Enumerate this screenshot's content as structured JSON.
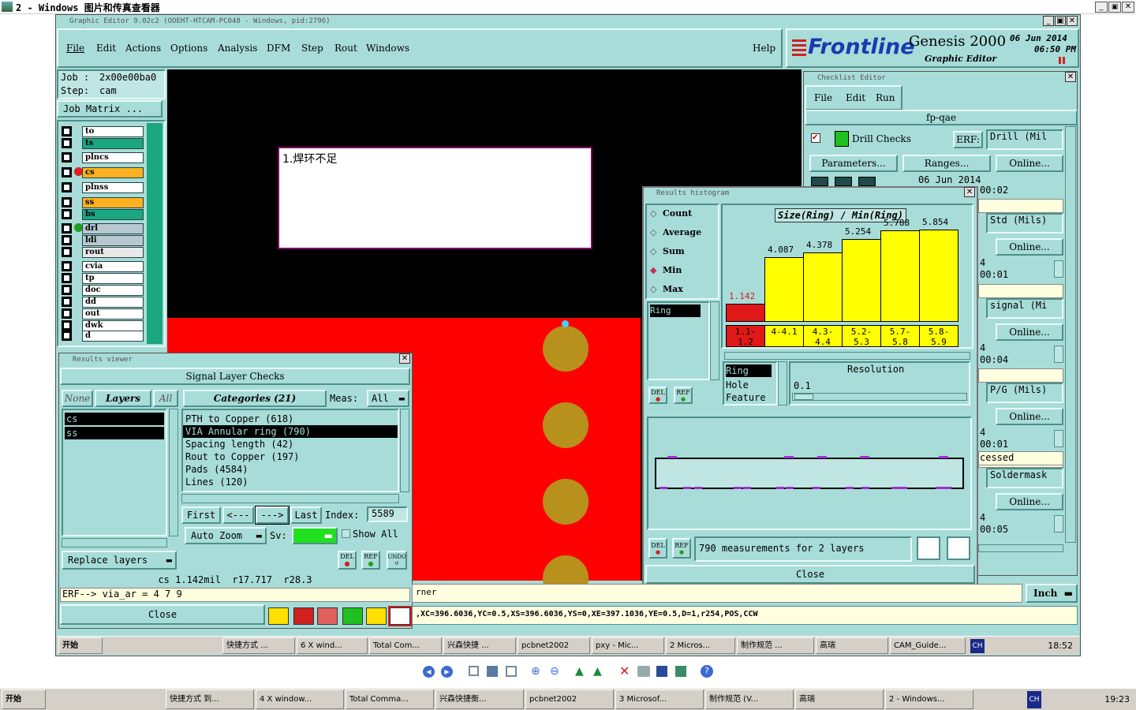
{
  "outer_title": "2 - Windows 图片和传真查看器",
  "editor_title": "Graphic Editor 9.02c2 (OOEHT-HTCAM-PC048 - Windows, pid:2796)",
  "menu": [
    "File",
    "Edit",
    "Actions",
    "Options",
    "Analysis",
    "DFM",
    "Step",
    "Rout",
    "Windows"
  ],
  "help_label": "Help",
  "brand": {
    "logo": "Frontline",
    "product": "Genesis 2000",
    "sub": "Graphic Editor",
    "date": "06 Jun 2014",
    "time": "06:50 PM"
  },
  "job": {
    "job_label": "Job :",
    "job_value": "2x00e00ba0",
    "step_label": "Step:",
    "step_value": "cam",
    "matrix_button": "Job Matrix ..."
  },
  "layers": [
    {
      "name": "to",
      "color": "#ffffff"
    },
    {
      "name": "ts",
      "color": "#1aa67f"
    },
    {
      "name": "plncs",
      "color": "#ffffff"
    },
    {
      "name": "cs",
      "color": "#ffb020"
    },
    {
      "name": "plnss",
      "color": "#ffffff"
    },
    {
      "name": "ss",
      "color": "#ffb020"
    },
    {
      "name": "bs",
      "color": "#1aa67f"
    },
    {
      "name": "drl",
      "color": "#b8c8d0"
    },
    {
      "name": "ldi",
      "color": "#b8c8d0"
    },
    {
      "name": "rout",
      "color": "#e8e8e8"
    },
    {
      "name": "cvia",
      "color": "#ffffff"
    },
    {
      "name": "tp",
      "color": "#ffffff"
    },
    {
      "name": "doc",
      "color": "#ffffff"
    },
    {
      "name": "dd",
      "color": "#ffffff"
    },
    {
      "name": "out",
      "color": "#ffffff"
    },
    {
      "name": "dwk",
      "color": "#ffffff"
    },
    {
      "name": "d",
      "color": "#ffffff"
    }
  ],
  "note_text": "1.焊环不足",
  "results_viewer": {
    "title": "Results viewer",
    "header": "Signal Layer Checks",
    "none": "None",
    "layers": "Layers",
    "all": "All",
    "categories": "Categories (21)",
    "meas_label": "Meas:",
    "meas_value": "All",
    "layer_items": [
      "cs",
      "ss"
    ],
    "category_items": [
      "PTH to Copper (618)",
      "VIA Annular ring (790)",
      "Spacing length (42)",
      "Rout to Copper (197)",
      "Pads (4584)",
      "Lines (120)"
    ],
    "first": "First",
    "prev": "<---",
    "next": "--->",
    "last": "Last",
    "index_label": "Index:",
    "index_value": "5589",
    "auto_zoom": "Auto Zoom",
    "sv_label": "Sv:",
    "show_all": "Show All",
    "replace_layers": "Replace layers",
    "status": "cs 1.142mil  r17.717  r28.3",
    "erf": "ERF--> via_ar = 4 7 9",
    "close": "Close",
    "del": "DEL",
    "ref": "REF",
    "undo": "UNDO"
  },
  "checklist": {
    "title": "Checklist Editor",
    "menu": [
      "File",
      "Edit",
      "Run"
    ],
    "name": "fp-qae",
    "check": "Drill Checks",
    "erf": "ERF:",
    "erf_values": [
      "Drill (Mil",
      "Std (Mils)",
      "signal (Mi",
      "P/G (Mils)",
      "Soldermask"
    ],
    "parameters": "Parameters...",
    "ranges": "Ranges...",
    "online": "Online...",
    "date": "06 Jun 2014",
    "times": [
      "00:02",
      "00:01",
      "00:04",
      "00:01",
      "00:05"
    ],
    "processed": "cessed",
    "inch": "Inch"
  },
  "histogram": {
    "title": "Results histogram",
    "modes": [
      "Count",
      "Average",
      "Sum",
      "Min",
      "Max"
    ],
    "selected_mode": "Min",
    "list_item": "Ring",
    "type_items": [
      "Ring",
      "Hole",
      "Feature"
    ],
    "resolution_label": "Resolution",
    "resolution_value": "0.1",
    "summary": "790 measurements for 2 layers",
    "close": "Close"
  },
  "chart_data": {
    "type": "bar",
    "title": "Size(Ring) / Min(Ring)",
    "categories": [
      "1.1-1.2",
      "4-4.1",
      "4.3-4.4",
      "5.2-5.3",
      "5.7-5.8",
      "5.8-5.9"
    ],
    "values": [
      1.142,
      4.087,
      4.378,
      5.254,
      5.788,
      5.854
    ],
    "value_labels": [
      "1.142",
      "4.087",
      "4.378",
      "5.254",
      "5.788",
      "5.854"
    ],
    "colors": [
      "#e01818",
      "#ffff00",
      "#ffff00",
      "#ffff00",
      "#ffff00",
      "#ffff00"
    ],
    "ylim": [
      0,
      6.5
    ]
  },
  "bottom_status": {
    "left": "rner",
    "coords": ",XC=396.6036,YC=0.5,XS=396.6036,YS=0,XE=397.1036,YE=0.5,D=1,r254,POS,CCW"
  },
  "inner_taskbar": {
    "start": "开始",
    "items": [
      "快捷方式 ...",
      "6 X wind...",
      "Total Com...",
      "兴森快捷 ...",
      "pcbnet2002",
      "pxy - Mic...",
      "2 Micros...",
      "制作规范 ...",
      "高瑞",
      "CAM_Guide..."
    ],
    "lang": "CH",
    "clock": "18:52"
  },
  "outer_taskbar": {
    "start": "开始",
    "items": [
      "快捷方式 到...",
      "4 X window...",
      "Total Comma...",
      "兴森快捷衡...",
      "pcbnet2002",
      "3 Microsof...",
      "制作规范 (V...",
      "高瑞",
      "2 - Windows..."
    ],
    "lang": "CH",
    "clock": "19:23"
  }
}
